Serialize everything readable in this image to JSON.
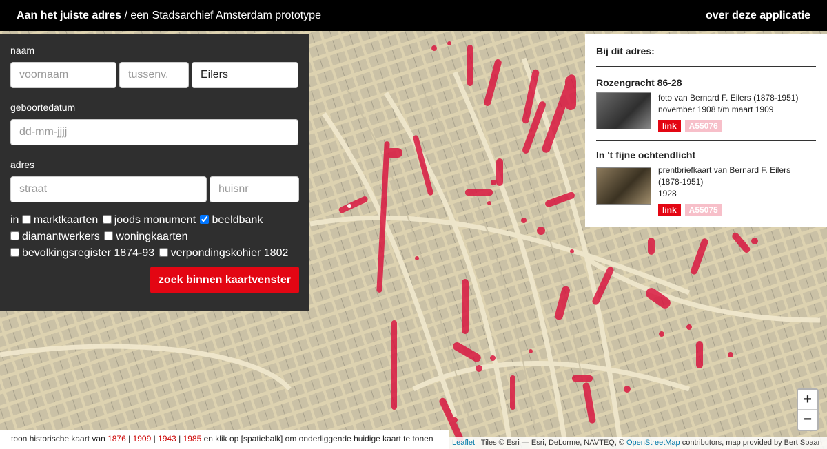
{
  "header": {
    "app_name": "Aan het juiste adres",
    "subtitle": " / een Stadsarchief Amsterdam prototype",
    "about_link": "over deze applicatie"
  },
  "search": {
    "name_label": "naam",
    "first_name_placeholder": "voornaam",
    "prefix_placeholder": "tussenv.",
    "last_name_value": "Eilers",
    "birthdate_label": "geboortedatum",
    "birthdate_placeholder": "dd-mm-jjjj",
    "address_label": "adres",
    "street_placeholder": "straat",
    "housenr_placeholder": "huisnr",
    "in_label": "in",
    "sources": [
      {
        "label": "marktkaarten",
        "checked": false
      },
      {
        "label": "joods monument",
        "checked": false
      },
      {
        "label": "beeldbank",
        "checked": true
      },
      {
        "label": "diamantwerkers",
        "checked": false
      },
      {
        "label": "woningkaarten",
        "checked": false
      },
      {
        "label": "bevolkingsregister 1874-93",
        "checked": false
      },
      {
        "label": "verpondingskohier 1802",
        "checked": false
      }
    ],
    "submit_label": "zoek binnen kaartvenster"
  },
  "results": {
    "heading": "Bij dit adres:",
    "items": [
      {
        "title": "Rozengracht 86-28",
        "line1": "foto van Bernard F. Eilers (1878-1951)",
        "line2": "november 1908 t/m maart 1909",
        "link_label": "link",
        "id": "A55076"
      },
      {
        "title": "In 't fijne ochtendlicht",
        "line1": "prentbriefkaart van Bernard F. Eilers (1878-1951)",
        "line2": "1928",
        "link_label": "link",
        "id": "A55075"
      }
    ]
  },
  "map_controls": {
    "zoom_in": "+",
    "zoom_out": "−"
  },
  "footer": {
    "prefix": "toon historische kaart van ",
    "years": [
      "1876",
      "1909",
      "1943",
      "1985"
    ],
    "separator": " | ",
    "suffix": " en klik op [spatiebalk] om onderliggende huidige kaart te tonen"
  },
  "attribution": {
    "leaflet": "Leaflet",
    "text1": " | Tiles © Esri — Esri, DeLorme, NAVTEQ, © ",
    "osm": "OpenStreetMap",
    "text2": " contributors, map provided by Bert Spaan"
  },
  "colors": {
    "accent": "#e30613",
    "marker": "#d8103c",
    "panel": "#2f2f2f",
    "topbar": "#000000"
  }
}
